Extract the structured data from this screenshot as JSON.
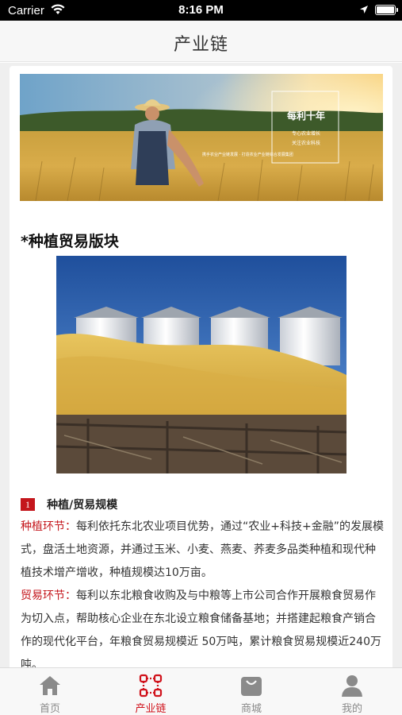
{
  "status_bar": {
    "carrier": "Carrier",
    "time": "8:16 PM"
  },
  "header": {
    "title": "产业链"
  },
  "banner": {
    "title": "每利十年",
    "lines": [
      "专心农业增长",
      "关注农业科技"
    ],
    "caption": "携手农业产业链发展 · 打造农业产业链综合发展集团"
  },
  "section": {
    "title": "*种植贸易版块",
    "sub_number": "1",
    "sub_title": "种植/贸易规模",
    "paragraphs": [
      {
        "label": "种植环节：",
        "text": "每利依托东北农业项目优势，通过“农业+科技+金融”的发展模式，盘活土地资源，并通过玉米、小麦、燕麦、荞麦多品类种植和现代种植技术增产增收，种植规模达10万亩。"
      },
      {
        "label": "贸易环节：",
        "text": "每利以东北粮食收购及与中粮等上市公司合作开展粮食贸易作为切入点，帮助核心企业在东北设立粮食储备基地；并搭建起粮食产销合作的现代化平台，年粮食贸易规模近 50万吨，累计粮食贸易规模近240万吨。"
      }
    ]
  },
  "tabbar": {
    "items": [
      {
        "label": "首页",
        "icon": "home-icon"
      },
      {
        "label": "产业链",
        "icon": "chain-icon",
        "active": true
      },
      {
        "label": "商城",
        "icon": "bag-icon"
      },
      {
        "label": "我的",
        "icon": "user-icon"
      }
    ]
  },
  "colors": {
    "accent": "#c4161c",
    "tab_active": "#d0121b",
    "tab_inactive": "#8a8a8a"
  }
}
